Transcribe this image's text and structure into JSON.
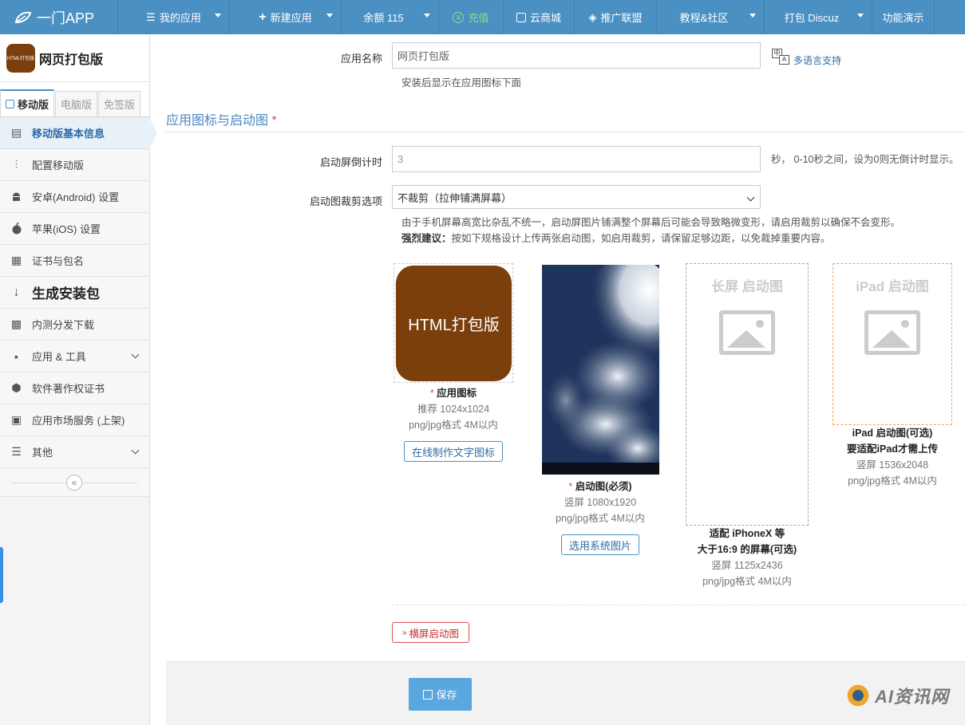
{
  "topnav": {
    "logo": "一门APP",
    "items": [
      {
        "icon": "list-icon",
        "label": "我的应用",
        "caret": true
      },
      {
        "icon": "plus-icon",
        "label": "新建应用",
        "caret": true
      },
      {
        "icon": "",
        "label": "余额 115",
        "caret": true
      },
      {
        "icon": "yen-icon",
        "label": "充值",
        "caret": false
      },
      {
        "icon": "shop-icon",
        "label": "云商城",
        "caret": false
      },
      {
        "icon": "diamond-icon",
        "label": "推广联盟",
        "caret": false
      },
      {
        "icon": "",
        "label": "教程&社区",
        "caret": true
      },
      {
        "icon": "",
        "label": "打包 Discuz",
        "caret": true
      },
      {
        "icon": "",
        "label": "功能演示",
        "caret": false
      }
    ]
  },
  "sidebar": {
    "app_icon_text": "HTML打包版",
    "app_name": "网页打包版",
    "version_tabs": [
      "移动版",
      "电脑版",
      "免签版"
    ],
    "items": [
      {
        "label": "移动版基本信息",
        "icon": "document-icon"
      },
      {
        "label": "配置移动版",
        "icon": "sliders-icon"
      },
      {
        "label": "安卓(Android) 设置",
        "icon": "android-icon"
      },
      {
        "label": "苹果(iOS) 设置",
        "icon": "apple-icon"
      },
      {
        "label": "证书与包名",
        "icon": "certificate-icon"
      },
      {
        "label": "生成安装包",
        "icon": "sort-icon"
      },
      {
        "label": "内测分发下载",
        "icon": "qrcode-icon"
      },
      {
        "label": "应用 & 工具",
        "icon": "grid-icon"
      },
      {
        "label": "软件著作权证书",
        "icon": "copyright-icon"
      },
      {
        "label": "应用市场服务 (上架)",
        "icon": "store-icon"
      },
      {
        "label": "其他",
        "icon": "menu-icon"
      }
    ],
    "collapse_symbol": "«"
  },
  "form": {
    "app_name_label": "应用名称",
    "app_name_value": "网页打包版",
    "app_name_hint": "安装后显示在应用图标下面",
    "multilang": "多语言支持",
    "section_title": "应用图标与启动图",
    "section_star": "*",
    "countdown_label": "启动屏倒计时",
    "countdown_value": "3",
    "countdown_hint": "秒， 0-10秒之间，设为0则无倒计时显示。",
    "crop_label": "启动图裁剪选项",
    "crop_value": "不裁剪（拉伸铺满屏幕）",
    "crop_hint1": "由于手机屏幕高宽比杂乱不统一，启动屏图片铺满整个屏幕后可能会导致略微变形，请启用裁剪以确保不会变形。",
    "crop_hint2_bold": "强烈建议：",
    "crop_hint2": "按如下规格设计上传两张启动图，如启用裁剪，请保留足够边距，以免裁掉重要内容。"
  },
  "cards": {
    "icon": {
      "image_text": "HTML打包版",
      "star": "*",
      "title": "应用图标",
      "line1": "推荐 1024x1024",
      "line2": "png/jpg格式 4M以内",
      "button": "在线制作文字图标"
    },
    "splash": {
      "star": "*",
      "title": "启动图(必须)",
      "line1": "竖屏 1080x1920",
      "line2": "png/jpg格式 4M以内",
      "button": "选用系统图片"
    },
    "long": {
      "placeholder": "长屏 启动图",
      "title1": "适配 iPhoneX 等",
      "title2": "大于16:9 的屏幕(可选)",
      "line1": "竖屏 1125x2436",
      "line2": "png/jpg格式 4M以内"
    },
    "ipad": {
      "placeholder": "iPad 启动图",
      "title1": "iPad 启动图(可选)",
      "title2": "要适配iPad才需上传",
      "line1": "竖屏 1536x2048",
      "line2": "png/jpg格式 4M以内"
    }
  },
  "landscape_button": "横屏启动图",
  "save_button": "保存",
  "watermark": "AI资讯网",
  "colors": {
    "nav": "#4a90c2",
    "accent": "#4a87c0",
    "icon_bg": "#7b3f0d",
    "required": "#d9534f"
  }
}
